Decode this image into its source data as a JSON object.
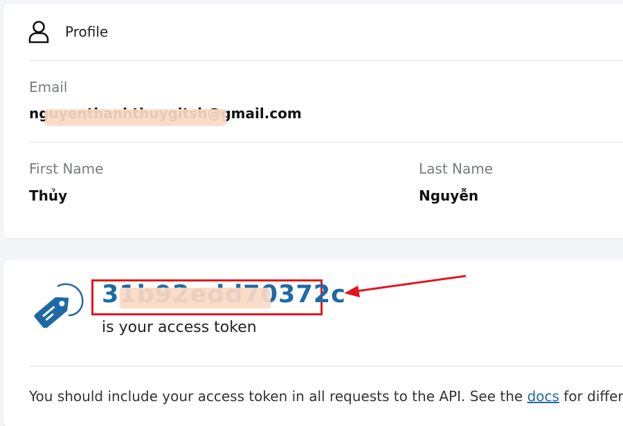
{
  "profile": {
    "title": "Profile",
    "icon": "user-icon",
    "email_label": "Email",
    "email_value": "nguyenthanhthuygitsh@gmail.com",
    "first_name_label": "First Name",
    "first_name_value": "Thủy",
    "last_name_label": "Last Name",
    "last_name_value": "Nguyễn"
  },
  "token": {
    "icon": "tag-icon",
    "value": "31b92edd70372c",
    "caption": "is your access token",
    "description_before_link": "You should include your access token in all requests to the API. See the ",
    "docs_link": "docs",
    "description_after_link": " for differen"
  },
  "colors": {
    "accent": "#1f6aa5",
    "annotation": "#e3161e",
    "page_background": "#f3f5f8",
    "redaction": "#fbd9c3"
  }
}
